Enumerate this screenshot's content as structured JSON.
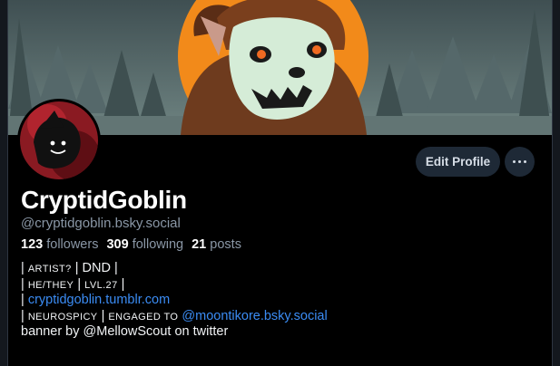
{
  "profile": {
    "display_name": "CryptidGoblin",
    "handle": "@cryptidgoblin.bsky.social"
  },
  "stats": {
    "followers_count": "123",
    "followers_label": "followers",
    "following_count": "309",
    "following_label": "following",
    "posts_count": "21",
    "posts_label": "posts"
  },
  "actions": {
    "edit_profile_label": "Edit Profile",
    "more_icon": "ellipsis-icon"
  },
  "bio": {
    "line1": {
      "bar1": "|",
      "artist": "ARTIST?",
      "bar2": "|",
      "dnd": "DND",
      "bar3": "|"
    },
    "line2": {
      "bar1": "|",
      "pronouns": "HE/THEY",
      "bar2": "|",
      "level": "LVL.27",
      "bar3": "|"
    },
    "line3": {
      "bar1": "|",
      "link": "cryptidgoblin.tumblr.com"
    },
    "line4": {
      "bar1": "|",
      "neuro": "NEUROSPICY",
      "bar2": "|",
      "engaged": "ENGAGED TO",
      "mention": "@moontikore.bsky.social"
    },
    "line5": "banner by @MellowScout on twitter"
  },
  "colors": {
    "background": "#000000",
    "link": "#3b8cf4",
    "button_bg": "#1e2936",
    "muted_text": "#8a97a6",
    "banner_sun": "#f28a1a"
  }
}
